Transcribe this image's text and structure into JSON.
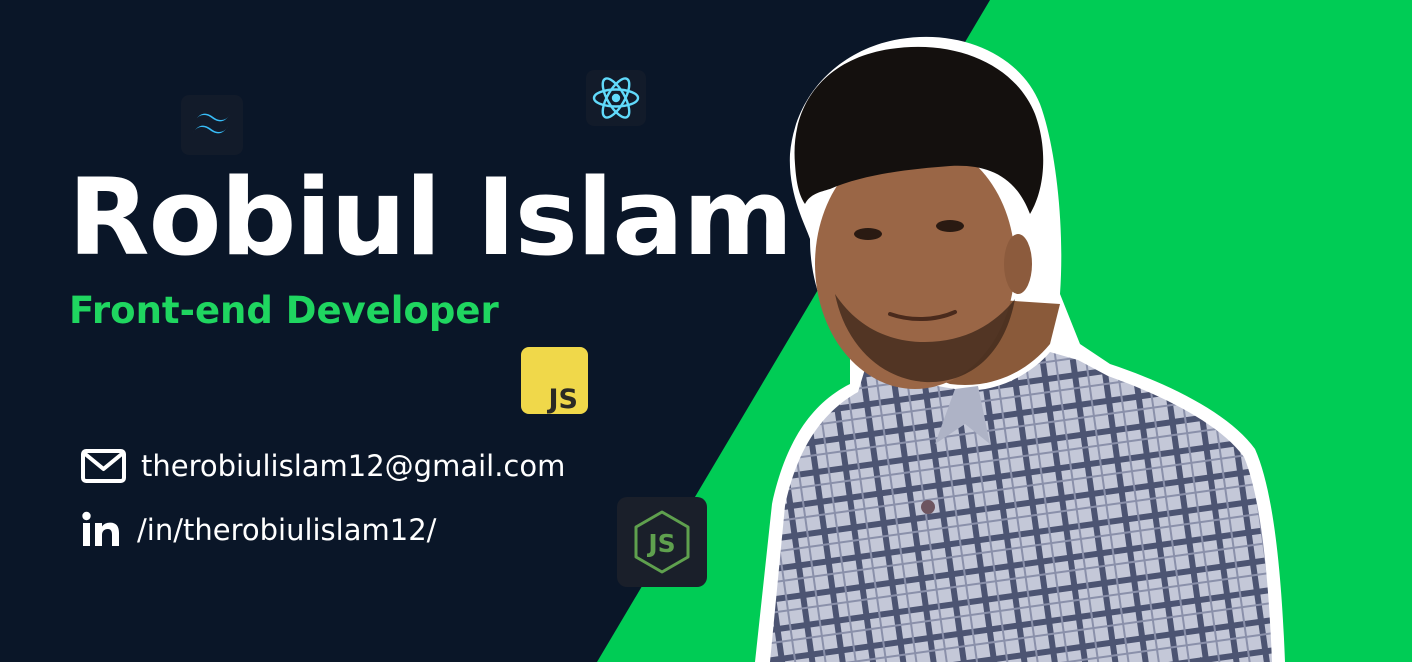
{
  "profile": {
    "name": "Robiul Islam",
    "role": "Front-end Developer"
  },
  "contacts": {
    "email": "therobiulislam12@gmail.com",
    "linkedin": "/in/therobiulislam12/"
  },
  "tech_badges": {
    "javascript": "JS",
    "nodejs": "JS"
  },
  "icons": {
    "email": "mail-icon",
    "linkedin": "linkedin-icon",
    "tailwind": "tailwind-icon",
    "react": "react-icon",
    "javascript": "javascript-icon",
    "nodejs": "nodejs-icon"
  },
  "colors": {
    "background": "#0a1628",
    "accent": "#00cc55",
    "role_text": "#1fd660",
    "text": "#ffffff",
    "js_yellow": "#f0d84a",
    "react_cyan": "#61dafb",
    "tailwind_cyan": "#38bdf8",
    "node_green": "#5fa04e"
  }
}
